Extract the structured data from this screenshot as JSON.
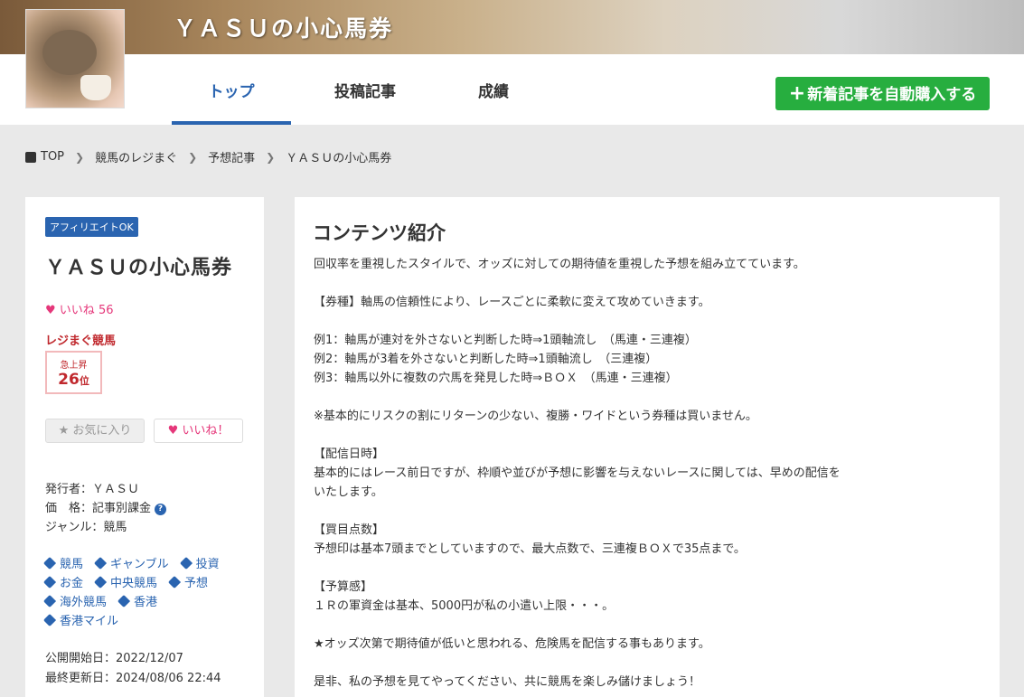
{
  "header": {
    "title": "ＹＡＳＵの小心馬券",
    "tabs": [
      {
        "label": "トップ"
      },
      {
        "label": "投稿記事"
      },
      {
        "label": "成績"
      }
    ],
    "buy_button": "新着記事を自動購入する"
  },
  "breadcrumb": [
    "TOP",
    "競馬のレジまぐ",
    "予想記事",
    "ＹＡＳＵの小心馬券"
  ],
  "sidebar": {
    "badge": "アフィリエイトOK",
    "title": "ＹＡＳＵの小心馬券",
    "likes_label": "いいね",
    "likes_count": "56",
    "rank_label": "レジまぐ競馬",
    "rank_status": "急上昇",
    "rank_value": "26",
    "rank_unit": "位",
    "fav_button": "お気に入り",
    "like_button": "いいね！",
    "publisher": "発行者：ＹＡＳＵ",
    "price": "価　格：記事別課金",
    "genre": "ジャンル：競馬",
    "tags": [
      "競馬",
      "ギャンブル",
      "投資",
      "お金",
      "中央競馬",
      "予想",
      "海外競馬",
      "香港",
      "香港マイル"
    ],
    "published": "公開開始日：2022/12/07",
    "updated": "最終更新日：2024/08/06 22:44"
  },
  "main": {
    "title": "コンテンツ紹介",
    "body": "回収率を重視したスタイルで、オッズに対しての期待値を重視した予想を組み立てています。\n\n【券種】軸馬の信頼性により、レースごとに柔軟に変えて攻めていきます。\n\n例1：軸馬が連対を外さないと判断した時⇒1頭軸流し　（馬連・三連複）\n例2：軸馬が3着を外さないと判断した時⇒1頭軸流し　（三連複）\n例3：軸馬以外に複数の穴馬を発見した時⇒ＢＯＸ　（馬連・三連複）\n\n※基本的にリスクの割にリターンの少ない、複勝・ワイドという券種は買いません。\n\n【配信日時】\n基本的にはレース前日ですが、枠順や並びが予想に影響を与えないレースに関しては、早めの配信を\nいたします。\n\n【買目点数】\n予想印は基本7頭までとしていますので、最大点数で、三連複ＢＯＸで35点まで。\n\n【予算感】\n１Ｒの軍資金は基本、5000円が私の小遣い上限・・・。\n\n★オッズ次第で期待値が低いと思われる、危険馬を配信する事もあります。\n\n是非、私の予想を見てやってください、共に競馬を楽しみ儲けましょう！"
  },
  "colors": {
    "accent": "#2a64b0",
    "buy_green": "#27ae3f",
    "like_pink": "#e5377a",
    "rank_red": "#c0282d"
  }
}
